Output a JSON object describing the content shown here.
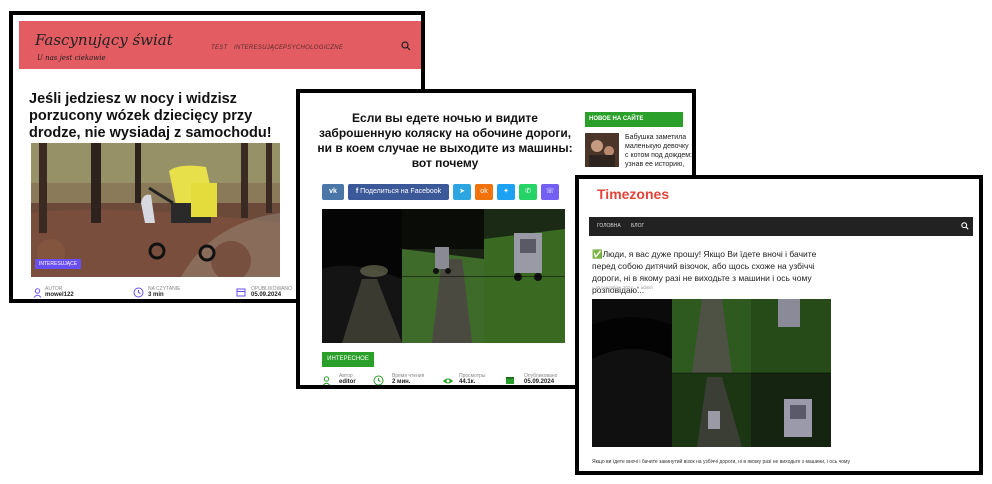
{
  "card1": {
    "site_title": "Fascynujący świat",
    "tagline": "U nas jest ciekawie",
    "nav": [
      "TEST",
      "INTERESUJĄCE",
      "PSYCHOLOGICZNE"
    ],
    "headline": "Jeśli jedziesz w nocy i widzisz porzucony wózek dziecięcy przy drodze, nie wysiadaj z samochodu!",
    "category": "INTERESUJĄCE",
    "meta": [
      {
        "label": "AUTOR",
        "value": "mowel122"
      },
      {
        "label": "NA CZYTANIE",
        "value": "3 min"
      },
      {
        "label": "OPUBLIKOWANO",
        "value": "05.09.2024"
      }
    ],
    "colors": {
      "header": "#e25c61",
      "badge": "#6a4ff0"
    }
  },
  "card2": {
    "headline": "Если вы едете ночью и видите заброшенную коляску на обочине дороги, ни в коем случае не выходите из машины: вот почему",
    "sidebar_heading": "НОВОЕ НА САЙТЕ",
    "sidebar_item": "Бабушка заметила маленькую девочку с котом под дождем: узнав ее историю,",
    "share_facebook": "Поделиться на Facebook",
    "share_icons": [
      "vk-icon",
      "facebook-icon",
      "telegram-icon",
      "odnoklassniki-icon",
      "twitter-icon",
      "whatsapp-icon",
      "viber-icon"
    ],
    "category": "ИНТЕРЕСНОЕ",
    "meta": [
      {
        "label": "Автор",
        "value": "editor"
      },
      {
        "label": "Время чтения",
        "value": "2 мин."
      },
      {
        "label": "Просмотры",
        "value": "44.1к."
      },
      {
        "label": "Опубликовано",
        "value": "05.09.2024"
      }
    ],
    "colors": {
      "accent": "#2aa02a"
    }
  },
  "card3": {
    "brand": "Timezones",
    "nav": [
      "ГОЛОВНА",
      "БЛОГ"
    ],
    "headline": "✅Люди, я вас дуже прошу! Якщо Ви їдете вночі і бачите перед собою дитячий візочок, або щось схоже на узбіччі дороги, ні в якому разі не виходьте з машини і ось чому розповідаю...",
    "date": "10 сентября, 2024",
    "author": "admin",
    "caption": "Якщо ви їдете вночі і бачите закинутий візок на узбіччі дороги, ні в якому разі не виходьте з машини, і ось чому",
    "colors": {
      "brand": "#e2443a",
      "navbar": "#222222"
    }
  }
}
